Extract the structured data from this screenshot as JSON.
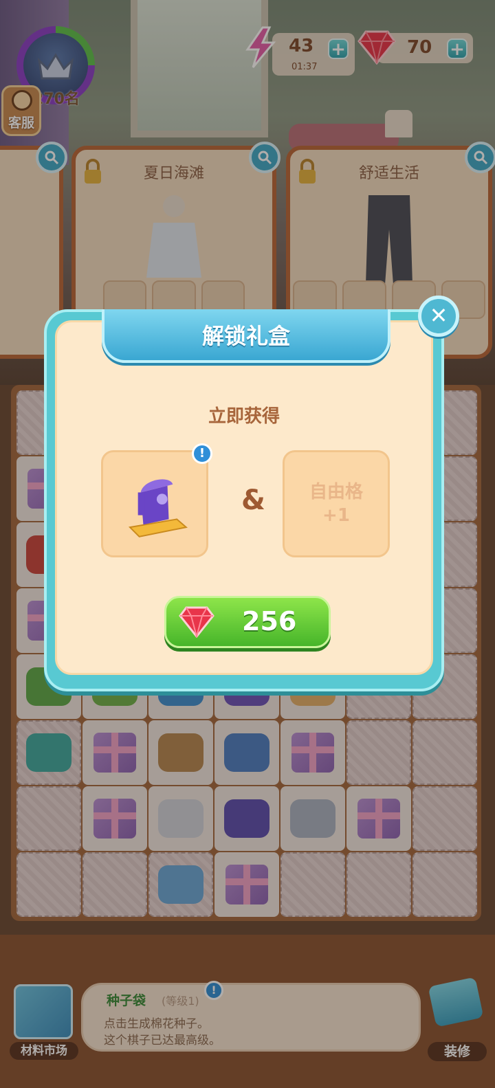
{
  "hud": {
    "rank_text": "270名",
    "service_label": "客服",
    "energy_value": "43",
    "energy_timer": "01:37",
    "gem_value": "70",
    "plus_symbol": "+"
  },
  "orders": [
    {
      "title": ""
    },
    {
      "title": "夏日海滩"
    },
    {
      "title": "舒适生活"
    }
  ],
  "dialog": {
    "title": "解锁礼盒",
    "subtitle": "立即获得",
    "separator": "&",
    "free_slot_line1": "自由格",
    "free_slot_line2": "+1",
    "info_mark": "!",
    "price": "256",
    "close_symbol": "✕"
  },
  "bottom": {
    "market_label": "材料市场",
    "item_name": "种子袋",
    "item_level": "(等级1)",
    "info_mark": "!",
    "line1": "点击生成棉花种子。",
    "line2": "这个棋子已达最高级。",
    "decorate_label": "装修"
  },
  "colors": {
    "dialog_border": "#58c9d2",
    "dialog_fill": "#fde9cb",
    "buy_button": "#46b52a",
    "gem_red": "#e8354a"
  }
}
